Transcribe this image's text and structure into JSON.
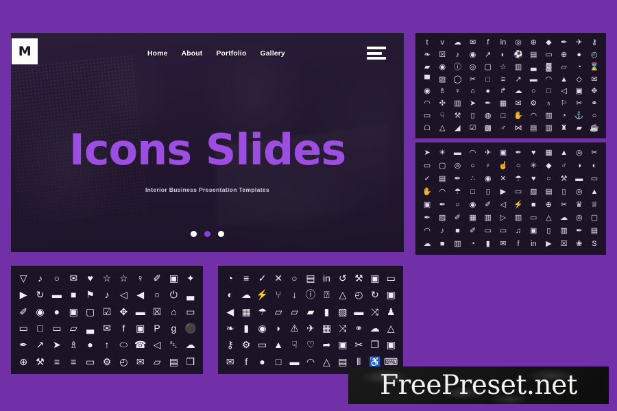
{
  "theme": {
    "background_purple": "#7230a8",
    "slide_dark": "#231a2e",
    "panel_dark": "#1d1327",
    "accent_purple": "#9b4ee0",
    "icon_white": "#f2eef7"
  },
  "hero": {
    "logo_letter": "M",
    "nav_items": [
      {
        "label": "Home"
      },
      {
        "label": "About"
      },
      {
        "label": "Portfolio"
      },
      {
        "label": "Gallery"
      }
    ],
    "menu_icon": "hamburger-menu-icon",
    "title": "Icons Slides",
    "subtitle": "Interior Business Presentation Templates",
    "carousel": {
      "total": 3,
      "active_index": 1,
      "active_color": "#8c3fd4",
      "inactive_color": "#ffffff"
    }
  },
  "panels": [
    {
      "id": "outline-1",
      "style": "outline",
      "columns": 12,
      "rows": 8,
      "icons": [
        "tumblr",
        "vimeo",
        "cloud-upload",
        "twitter",
        "facebook",
        "linkedin",
        "map-pin",
        "globe",
        "diamond",
        "pen",
        "airplane",
        "key",
        "foot",
        "trash",
        "headphones",
        "webcam",
        "rocket",
        "binoculars",
        "soccer-ball",
        "building",
        "folder",
        "globe-grid",
        "mouse",
        "clock",
        "eraser",
        "eye",
        "info-circle",
        "target",
        "window",
        "star",
        "id-card",
        "signal-bars",
        "tie",
        "tag",
        "palette",
        "hourglass",
        "mobile",
        "image",
        "speech-bubble",
        "whisk",
        "shopping-bag",
        "filter",
        "chart-line",
        "briefcase",
        "wifi",
        "lamp",
        "gem",
        "envelope-open",
        "eye-scan",
        "trophy",
        "medal",
        "hanger",
        "money-bag",
        "share",
        "cloud-cash",
        "watch",
        "square",
        "speaker",
        "picture-frame",
        "puzzle",
        "cloche",
        "molecule",
        "presentation",
        "paper-plane",
        "pin",
        "calendar",
        "mail",
        "gear-globe",
        "user-gear",
        "podium",
        "scissors",
        "rings",
        "truck",
        "thumb-down",
        "tools",
        "clipboard",
        "cd",
        "shopping-bag-2",
        "handshake",
        "hat",
        "book",
        "head-profile",
        "anchor",
        "balloon",
        "lamp-desk",
        "satellite",
        "factory",
        "note-edit",
        "window-frame",
        "user-speaker",
        "bowtie",
        "city",
        "columns",
        "chess",
        "cash",
        "hot-drink"
      ]
    },
    {
      "id": "outline-2",
      "style": "outline",
      "columns": 12,
      "rows": 8,
      "icons": [
        "paper-plane",
        "sun",
        "briefcase",
        "graduation-cap",
        "airplane",
        "photo-frame",
        "spray",
        "heart-wide",
        "calculator",
        "fire",
        "compass",
        "scissors",
        "file",
        "monitor",
        "map-pin",
        "lightbulb",
        "user",
        "thumbs-up",
        "watch",
        "asterisk",
        "diamond",
        "user-solid",
        "masks",
        "binoculars",
        "check-hand",
        "id-badge",
        "feather",
        "group",
        "eye",
        "arrow-cross",
        "umbrella",
        "heart",
        "balloon",
        "gavel",
        "briefcase-2",
        "capsule",
        "hand",
        "rss",
        "umbrella-2",
        "shopping-cart",
        "battery",
        "video-camera",
        "car",
        "photo",
        "printer",
        "file-page",
        "compass-2",
        "flame",
        "camera",
        "pen",
        "search",
        "eye-2",
        "paperclip",
        "megaphone",
        "bolt",
        "lock",
        "globe",
        "scissors-2",
        "crown",
        "crown-2",
        "dropper",
        "image-arrow",
        "brush",
        "calendar",
        "book",
        "play-box",
        "article",
        "video-box",
        "inbox",
        "cloud",
        "camera-2",
        "monitor-2",
        "headphone-arc",
        "headphones",
        "briefcase-lock",
        "pencil",
        "chat",
        "car-2",
        "music",
        "camera-box",
        "document",
        "store",
        "pen-2",
        "user-card",
        "cloud-download",
        "lock-2",
        "id-card",
        "speedometer",
        "microphone",
        "twitter",
        "facebook",
        "linkedin",
        "youtube",
        "trash",
        "badge",
        "skype"
      ]
    },
    {
      "id": "solid-1",
      "style": "solid",
      "columns": 11,
      "rows": 6,
      "icons": [
        "martini-glass",
        "music-note",
        "search",
        "envelope",
        "heart",
        "star",
        "star-outline",
        "user",
        "paperclip",
        "floppy-disk",
        "magic-wand",
        "video-camera",
        "refresh",
        "credit-card",
        "lock",
        "flag",
        "headphones",
        "volume-mute",
        "volume-up",
        "search-zoom",
        "power",
        "signal-bars",
        "pencil",
        "map-marker",
        "droplet",
        "edit-square",
        "share-square",
        "check-square",
        "move",
        "briefcase",
        "trash",
        "home",
        "file",
        "comment",
        "shopping-cart",
        "folder",
        "folder-open",
        "bar-chart",
        "twitter",
        "facebook",
        "instagram",
        "pinterest",
        "google-plus",
        "flickr",
        "thumbtack",
        "external-link",
        "sign-in",
        "trophy",
        "github",
        "upload",
        "ellipse",
        "phone",
        "megaphone",
        "bell",
        "cloud",
        "globe",
        "wrench",
        "list",
        "filter",
        "truck",
        "gear",
        "clock",
        "envelope-2",
        "tag",
        "save",
        "copy"
      ]
    },
    {
      "id": "solid-2",
      "style": "solid",
      "columns": 11,
      "rows": 6,
      "icons": [
        "pie-chart",
        "list",
        "check",
        "close",
        "search",
        "print",
        "linkedin",
        "undo",
        "gavel",
        "rss-square",
        "comment",
        "binoculars",
        "cloud-comment",
        "bolt",
        "sitemap",
        "download",
        "info-circle",
        "question-circle",
        "inbox",
        "clock-circle",
        "redo",
        "camera",
        "volume-up",
        "qr-code",
        "umbrella",
        "tag",
        "tags",
        "eraser",
        "bookmark",
        "image",
        "briefcase",
        "shuffle",
        "users",
        "leaf",
        "microphone-slash",
        "eye",
        "eye-slash",
        "warning",
        "airplane",
        "calendar",
        "random",
        "link",
        "cloud",
        "flask",
        "key",
        "cogs",
        "comments",
        "fire",
        "thumbs-down",
        "heart-outline",
        "sign-out",
        "linkedin-square",
        "cut",
        "copy",
        "bookmark-square",
        "twitter",
        "facebook",
        "github",
        "unlock",
        "credit-card",
        "rss",
        "inbox-2",
        "save",
        "sliders",
        "wheelchair",
        "keyboard"
      ]
    }
  ],
  "watermark": {
    "text": "FreePreset.net"
  }
}
